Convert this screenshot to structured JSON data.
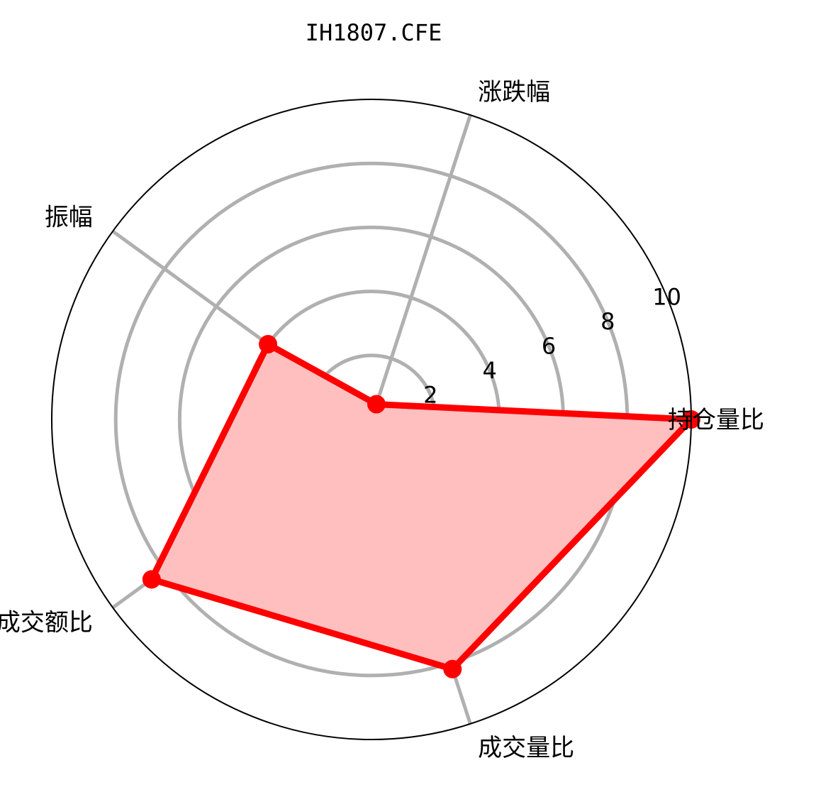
{
  "chart_data": {
    "type": "radar",
    "title": "IH1807.CFE",
    "categories": [
      "持仓量比",
      "涨跌幅",
      "振幅",
      "成交额比",
      "成交量比"
    ],
    "series": [
      {
        "values": [
          10.0,
          0.5,
          4.0,
          8.5,
          8.2
        ],
        "color": "#ff0000",
        "fill": "#ffbfbf"
      }
    ],
    "rlim": [
      0,
      10
    ],
    "rticks": [
      2,
      4,
      6,
      8,
      10
    ],
    "rtick_labels": [
      "2",
      "4",
      "6",
      "8",
      "10"
    ],
    "grid": true,
    "grid_color": "#b0b0b0",
    "outline_color": "#000000"
  }
}
